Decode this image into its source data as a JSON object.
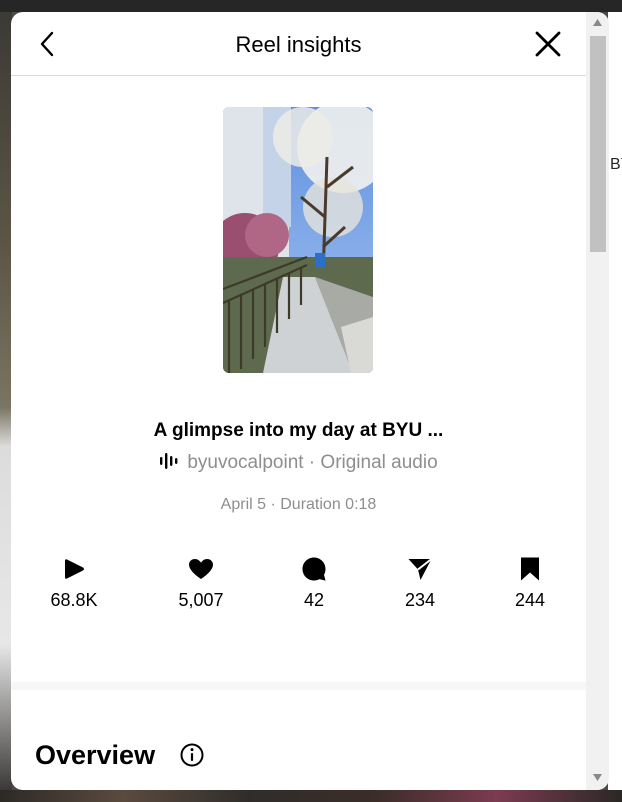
{
  "background": {
    "right_edge_text": "BY"
  },
  "header": {
    "title": "Reel insights",
    "back_icon": "chevron-left-icon",
    "close_icon": "close-icon"
  },
  "reel": {
    "title": "A glimpse into my day at BYU ...",
    "audio_icon": "audio-waveform-icon",
    "audio": "byuvocalpoint · Original audio",
    "meta": "April 5 · Duration 0:18"
  },
  "stats": [
    {
      "icon": "play-icon",
      "value": "68.8K"
    },
    {
      "icon": "heart-icon",
      "value": "5,007"
    },
    {
      "icon": "comment-icon",
      "value": "42"
    },
    {
      "icon": "share-icon",
      "value": "234"
    },
    {
      "icon": "bookmark-icon",
      "value": "244"
    }
  ],
  "overview": {
    "title": "Overview",
    "icon": "info-icon"
  },
  "colors": {
    "text_primary": "#000000",
    "text_secondary": "#8e8e8e",
    "divider": "#dbdbdb"
  }
}
